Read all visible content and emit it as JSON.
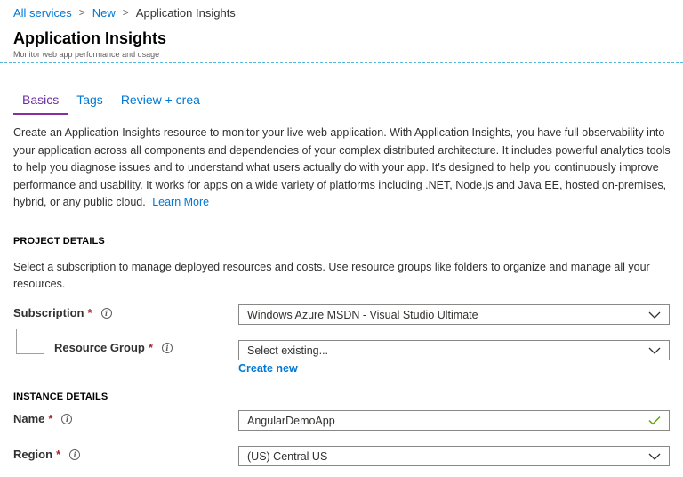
{
  "breadcrumb": {
    "items": [
      "All services",
      "New",
      "Application Insights"
    ],
    "separator": ">"
  },
  "header": {
    "title": "Application Insights",
    "subtitle": "Monitor web app performance and usage"
  },
  "tabs": [
    {
      "label": "Basics",
      "active": true
    },
    {
      "label": "Tags",
      "active": false
    },
    {
      "label": "Review + crea",
      "active": false
    }
  ],
  "description": {
    "text": "Create an Application Insights resource to monitor your live web application. With Application Insights, you have full observability into your application across all components and dependencies of your complex distributed architecture. It includes powerful analytics tools to help you diagnose issues and to understand what users actually do with your app. It's designed to help you continuously improve performance and usability. It works for apps on a wide variety of platforms including .NET, Node.js and Java EE, hosted on-premises, hybrid, or any public cloud.",
    "link": "Learn More"
  },
  "project_details": {
    "heading": "PROJECT DETAILS",
    "description": "Select a subscription to manage deployed resources and costs. Use resource groups like folders to organize and manage all your resources.",
    "subscription": {
      "label": "Subscription",
      "required_mark": "*",
      "info_icon": "i",
      "value": "Windows Azure MSDN - Visual Studio Ultimate"
    },
    "resource_group": {
      "label": "Resource Group",
      "required_mark": "*",
      "info_icon": "i",
      "value": "Select existing...",
      "create_new": "Create new"
    }
  },
  "instance_details": {
    "heading": "INSTANCE DETAILS",
    "name": {
      "label": "Name",
      "required_mark": "*",
      "info_icon": "i",
      "value": "AngularDemoApp",
      "valid": true
    },
    "region": {
      "label": "Region",
      "required_mark": "*",
      "info_icon": "i",
      "value": "(US) Central US"
    }
  },
  "colors": {
    "link": "#0078d4",
    "active_tab": "#6b2fa0",
    "required": "#a4262c",
    "valid_check": "#57a300",
    "header_divider": "#59b4d9"
  }
}
